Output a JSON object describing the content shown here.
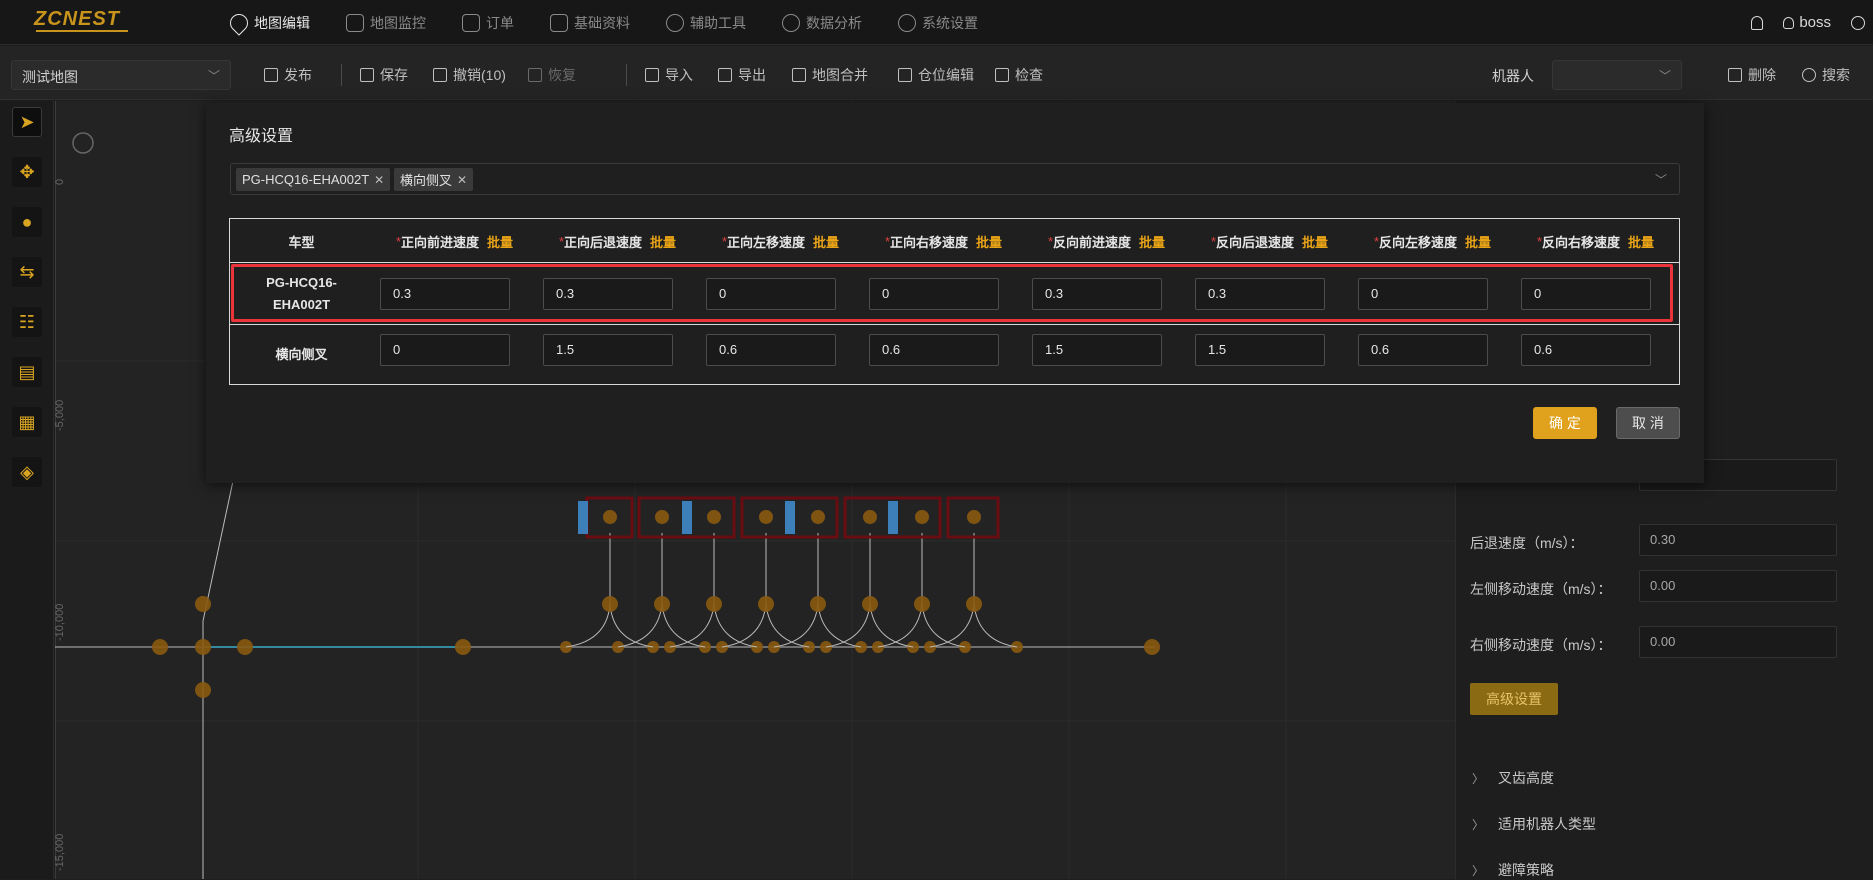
{
  "app": {
    "logo": "ZCNEST",
    "user": "boss"
  },
  "nav": [
    {
      "label": "地图编辑",
      "icon": "map-pin-icon"
    },
    {
      "label": "地图监控",
      "icon": "chart-icon"
    },
    {
      "label": "订单",
      "icon": "order-icon"
    },
    {
      "label": "基础资料",
      "icon": "sliders-icon"
    },
    {
      "label": "辅助工具",
      "icon": "gear-icon"
    },
    {
      "label": "数据分析",
      "icon": "gear-icon"
    },
    {
      "label": "系统设置",
      "icon": "gear-icon"
    }
  ],
  "toolbar": {
    "map_name": "测试地图",
    "publish": "发布",
    "save": "保存",
    "undo": "撤销(10)",
    "redo": "恢复",
    "import": "导入",
    "export": "导出",
    "merge": "地图合并",
    "location_edit": "仓位编辑",
    "check": "检查",
    "robot_label": "机器人",
    "delete": "删除",
    "search": "搜索"
  },
  "right_panel": {
    "back_speed_label": "后退速度（m/s）：",
    "back_speed_value": "0.30",
    "left_speed_label": "左侧移动速度（m/s）：",
    "left_speed_value": "0.00",
    "right_speed_label": "右侧移动速度（m/s）：",
    "right_speed_value": "0.00",
    "advanced_button": "高级设置",
    "sections": [
      "叉齿高度",
      "适用机器人类型",
      "避障策略"
    ]
  },
  "canvas": {
    "axis_labels": [
      "0",
      "-5,000",
      "-10,000",
      "-15,000"
    ]
  },
  "modal": {
    "title": "高级设置",
    "tags": [
      "PG-HCQ16-EHA002T",
      "横向侧叉"
    ],
    "headers": {
      "type": "车型",
      "batch": "批量",
      "columns": [
        "正向前进速度",
        "正向后退速度",
        "正向左移速度",
        "正向右移速度",
        "反向前进速度",
        "反向后退速度",
        "反向左移速度",
        "反向右移速度"
      ]
    },
    "rows": [
      {
        "name_line1": "PG-HCQ16-",
        "name_line2": "EHA002T",
        "values": [
          "0.3",
          "0.3",
          "0",
          "0",
          "0.3",
          "0.3",
          "0",
          "0"
        ]
      },
      {
        "name_line1": "横向侧叉",
        "name_line2": "",
        "values": [
          "0",
          "1.5",
          "0.6",
          "0.6",
          "1.5",
          "1.5",
          "0.6",
          "0.6"
        ]
      }
    ],
    "ok": "确 定",
    "cancel": "取 消"
  }
}
